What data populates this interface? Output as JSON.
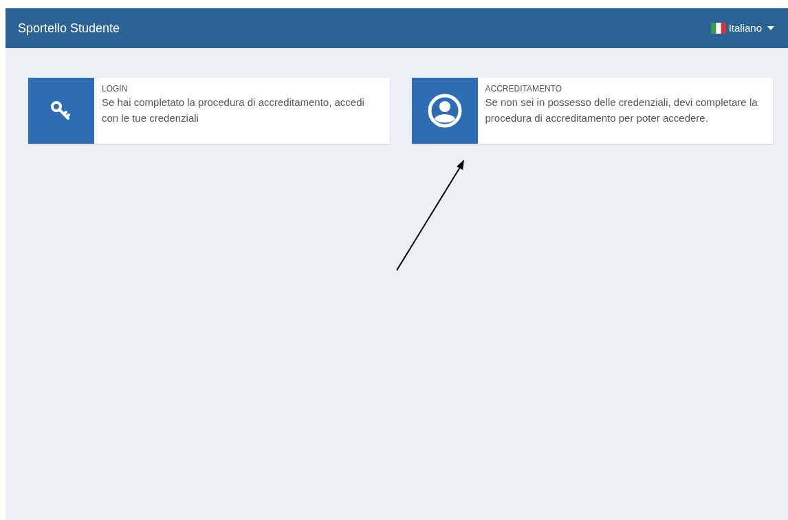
{
  "header": {
    "title": "Sportello Studente",
    "language": {
      "label": "Italiano"
    }
  },
  "cards": [
    {
      "kind": "key",
      "title": "LOGIN",
      "text": "Se hai completato la procedura di accreditamento, accedi con le tue credenziali"
    },
    {
      "kind": "user",
      "title": "ACCREDITAMENTO",
      "text": "Se non sei in possesso delle credenziali, devi completare la procedura di accreditamento per poter accedere."
    }
  ]
}
